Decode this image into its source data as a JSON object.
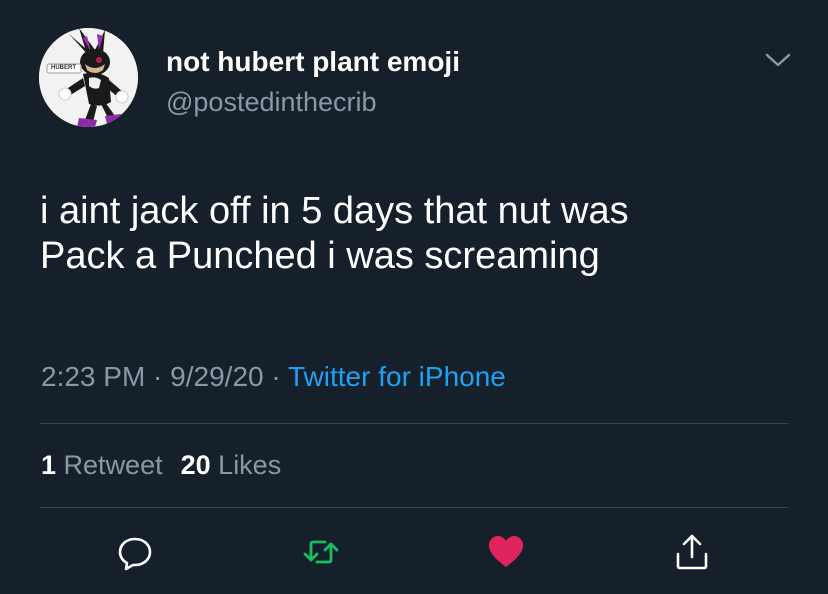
{
  "tweet": {
    "display_name": "not hubert plant emoji",
    "handle": "@postedinthecrib",
    "text_lines": [
      "i aint jack off in 5 days that nut was",
      "Pack a Punched i was screaming"
    ],
    "time": "2:23 PM",
    "sep1": " · ",
    "date": "9/29/20",
    "sep2": " · ",
    "source": "Twitter for iPhone"
  },
  "stats": {
    "retweets_count": "1",
    "retweets_label": "Retweet",
    "likes_count": "20",
    "likes_label": "Likes"
  },
  "avatar": {
    "patch_text": "HUBERT"
  },
  "icons": {
    "reply": "reply-icon",
    "retweet": "retweet-icon",
    "like": "heart-icon",
    "share": "share-icon",
    "menu": "chevron-down-icon"
  },
  "colors": {
    "background": "#15202b",
    "text": "#ffffff",
    "secondary": "#8899a6",
    "link": "#1da1f2",
    "retweet_active": "#17bf63",
    "like_active": "#e0245e",
    "divider": "#38444d"
  }
}
